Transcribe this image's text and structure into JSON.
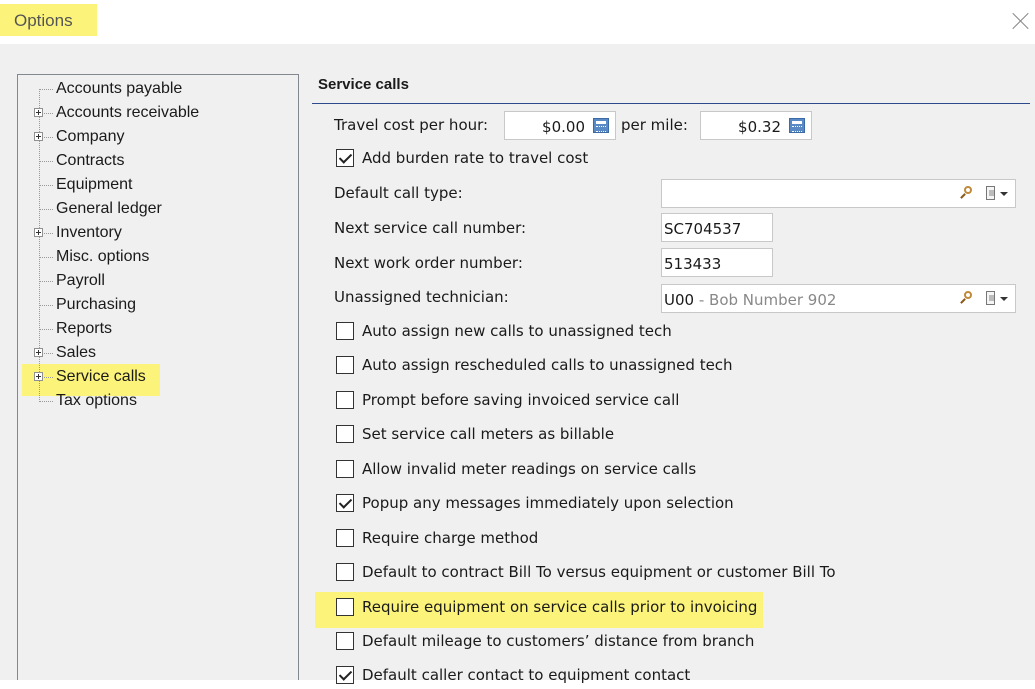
{
  "window": {
    "title": "Options"
  },
  "tree": {
    "items": [
      {
        "label": "Accounts payable",
        "expandable": false
      },
      {
        "label": "Accounts receivable",
        "expandable": true
      },
      {
        "label": "Company",
        "expandable": true
      },
      {
        "label": "Contracts",
        "expandable": false
      },
      {
        "label": "Equipment",
        "expandable": false
      },
      {
        "label": "General ledger",
        "expandable": false
      },
      {
        "label": "Inventory",
        "expandable": true
      },
      {
        "label": "Misc. options",
        "expandable": false
      },
      {
        "label": "Payroll",
        "expandable": false
      },
      {
        "label": "Purchasing",
        "expandable": false
      },
      {
        "label": "Reports",
        "expandable": false
      },
      {
        "label": "Sales",
        "expandable": true
      },
      {
        "label": "Service calls",
        "expandable": true,
        "selected": true
      },
      {
        "label": "Tax options",
        "expandable": false
      }
    ]
  },
  "panel": {
    "title": "Service calls",
    "travel_cost_label": "Travel cost per hour:",
    "travel_cost_value": "$0.00",
    "per_mile_label": "per mile:",
    "per_mile_value": "$0.32",
    "burden_label": "Add burden rate to travel cost",
    "default_call_type_label": "Default call type:",
    "default_call_type_value": "",
    "next_call_label": "Next service call number:",
    "next_call_value": "SC704537",
    "next_wo_label": "Next work order number:",
    "next_wo_value": "513433",
    "unassigned_label": "Unassigned technician:",
    "unassigned_code": "U00",
    "unassigned_name": " - Bob Number 902",
    "checkboxes": [
      {
        "label": "Auto assign new calls to unassigned tech",
        "checked": false
      },
      {
        "label": "Auto assign rescheduled calls to unassigned tech",
        "checked": false
      },
      {
        "label": "Prompt before saving invoiced service call",
        "checked": false
      },
      {
        "label": "Set service call meters as billable",
        "checked": false
      },
      {
        "label": "Allow invalid meter readings on service calls",
        "checked": false
      },
      {
        "label": "Popup any messages immediately upon selection",
        "checked": true
      },
      {
        "label": "Require charge method",
        "checked": false
      },
      {
        "label": "Default to contract Bill To versus equipment or customer Bill To",
        "checked": false
      },
      {
        "label": "Require equipment on service calls prior to invoicing",
        "checked": false
      },
      {
        "label": "Default mileage to customers’ distance from branch",
        "checked": false
      },
      {
        "label": "Default caller contact to equipment contact",
        "checked": true
      }
    ]
  },
  "colors": {
    "highlight": "#fcf47a",
    "rule": "#2c4a8c"
  }
}
